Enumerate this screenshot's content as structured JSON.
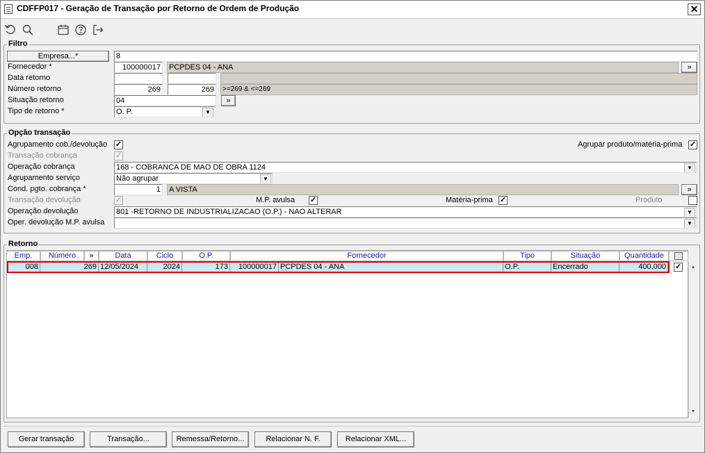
{
  "window": {
    "title": "CDFFP017 - Geração de Transação por Retorno de Ordem de Produção",
    "close_label": "✕"
  },
  "toolbar": {
    "icons": [
      "undo-icon",
      "search-icon",
      "calendar-icon",
      "help-icon",
      "exit-icon"
    ]
  },
  "filtro": {
    "legend": "Filtro",
    "empresa_button": "Empresa...*",
    "empresa_value": "8",
    "fornecedor_label": "Fornecedor *",
    "fornecedor_code": "100000017",
    "fornecedor_name": "PCPDES 04 - ANA",
    "data_retorno_label": "Data retorno",
    "data_retorno_from": "",
    "data_retorno_to": "",
    "numero_retorno_label": "Número retorno",
    "numero_from": "269",
    "numero_to": "269",
    "numero_expr": ">=269 & <=269",
    "situacao_label": "Situação retorno",
    "situacao_value": "04",
    "tipo_label": "Tipo de retorno *",
    "tipo_value": "O. P.",
    "more_label": "»"
  },
  "opcao": {
    "legend": "Opção transação",
    "agrup_cob_label": "Agrupamento cob./devolução",
    "agrup_cob_checked": "✓",
    "agrup_prod_label": "Agrupar produto/matéria-prima",
    "agrup_prod_checked": "✓",
    "trans_cob_label": "Transação cobrança",
    "trans_cob_checked": "✓",
    "op_cob_label": "Operação cobrança",
    "op_cob_value": "168 - COBRANCA DE MAO DE OBRA 1124",
    "agrup_serv_label": "Agrupamento serviço",
    "agrup_serv_value": "Não agrupar",
    "cond_pgto_label": "Cond. pgto. cobrança *",
    "cond_pgto_code": "1",
    "cond_pgto_name": "A VISTA",
    "trans_dev_label": "Transação devolução",
    "trans_dev_checked": "✓",
    "mp_avulsa_label": "M.P. avulsa",
    "mp_avulsa_checked": "✓",
    "materia_label": "Matéria-prima",
    "materia_checked": "✓",
    "produto_label": "Produto",
    "produto_checked": "",
    "op_dev_label": "Operação devolução",
    "op_dev_value": "801 -RETORNO DE INDUSTRIALIZACAO (O.P.) - NAO ALTERAR",
    "op_dev_mp_label": "Oper. devolução M.P. avulsa",
    "op_dev_mp_value": "",
    "more_label": "»"
  },
  "retorno": {
    "legend": "Retorno",
    "columns": [
      "Emp.",
      "Número",
      "»",
      "Data",
      "Ciclo",
      "O.P.",
      "Fornecedor",
      "Tipo",
      "Situação",
      "Quantidade"
    ],
    "rows": [
      {
        "emp": "008",
        "numero": "269",
        "data": "12/05/2024",
        "ciclo": "2024",
        "op": "173",
        "fornecedor_code": "100000017",
        "fornecedor_name": "PCPDES 04 - ANA",
        "tipo": "O.P.",
        "situacao": "Encerrado",
        "quantidade": "400,000",
        "checked": "✓"
      }
    ]
  },
  "buttons": {
    "gerar": "Gerar transação",
    "transacao": "Transação...",
    "remessa": "Remessa/Retorno...",
    "relacionar_nf": "Relacionar N. F.",
    "relacionar_xml": "Relacionar XML..."
  },
  "colors": {
    "selected_row_bg": "#cfe6f5",
    "selected_row_border": "#e00000",
    "grid_header_text": "#1a1aa0"
  }
}
